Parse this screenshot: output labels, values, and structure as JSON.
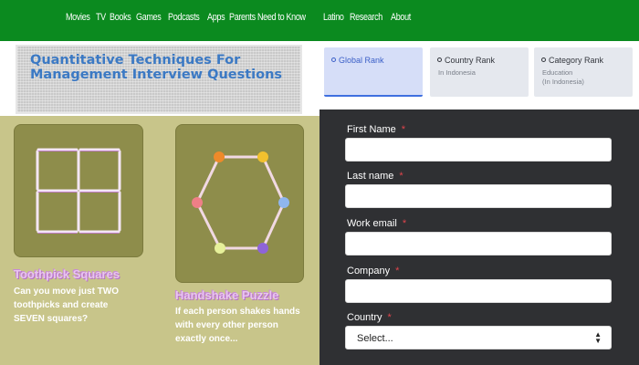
{
  "nav": {
    "items": [
      "Movies",
      "TV",
      "Books",
      "Games",
      "Podcasts",
      "Apps",
      "Parents Need to Know",
      "Latino",
      "Research",
      "About"
    ]
  },
  "banner": {
    "title": "Quantitative Techniques For Management Interview Questions"
  },
  "puzzles": [
    {
      "title": "Toothpick Squares",
      "description": "Can you move just TWO toothpicks and create SEVEN squares?"
    },
    {
      "title": "Handshake Puzzle",
      "description": "If each person shakes hands with every other person exactly once..."
    }
  ],
  "tabs": [
    {
      "label": "Global Rank",
      "sub": "",
      "icon": "globe-icon"
    },
    {
      "label": "Country Rank",
      "sub": "In Indonesia",
      "icon": "globe-icon"
    },
    {
      "label": "Category Rank",
      "sub": "Education\n(In Indonesia)",
      "icon": "globe-icon"
    }
  ],
  "form": {
    "first_name": {
      "label": "First Name",
      "required": "*"
    },
    "last_name": {
      "label": "Last name",
      "required": "*"
    },
    "work_email": {
      "label": "Work email",
      "required": "*"
    },
    "company": {
      "label": "Company",
      "required": "*"
    },
    "country": {
      "label": "Country",
      "required": "*",
      "selected": "Select..."
    }
  },
  "colors": {
    "nav_bg": "#0b8a1f",
    "puzzle_bg": "#c8c58a",
    "form_bg": "#2f3033",
    "required": "#e0444c",
    "active_tab": "#3f6fe0"
  }
}
